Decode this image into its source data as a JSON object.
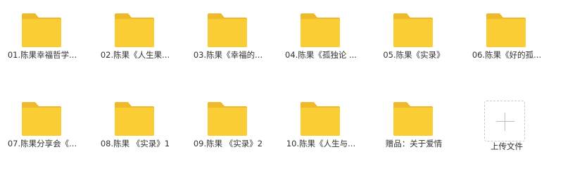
{
  "colors": {
    "folder_back": "#F0B92A",
    "folder_front": "#F9CD33",
    "label_text": "#333333",
    "upload_border": "#C9C9C9"
  },
  "files": [
    {
      "name": "01.陈果幸福哲学...",
      "icon": "folder-icon"
    },
    {
      "name": "02.陈果《人生果...",
      "icon": "folder-icon"
    },
    {
      "name": "03.陈果《幸福的...",
      "icon": "folder-icon"
    },
    {
      "name": "04.陈果《孤独论 ...",
      "icon": "folder-icon"
    },
    {
      "name": "05.陈果《实录》",
      "icon": "folder-icon"
    },
    {
      "name": "06.陈果《好的孤...",
      "icon": "folder-icon"
    },
    {
      "name": "07.陈果分享会《...",
      "icon": "folder-icon"
    },
    {
      "name": "08.陈果 《实录》1",
      "icon": "folder-icon"
    },
    {
      "name": "09.陈果 《实录》2",
      "icon": "folder-icon"
    },
    {
      "name": "10.陈果《人生与...",
      "icon": "folder-icon"
    },
    {
      "name": "赠品：关于爱情",
      "icon": "folder-icon"
    }
  ],
  "upload": {
    "label": "上传文件",
    "icon": "plus-icon"
  }
}
